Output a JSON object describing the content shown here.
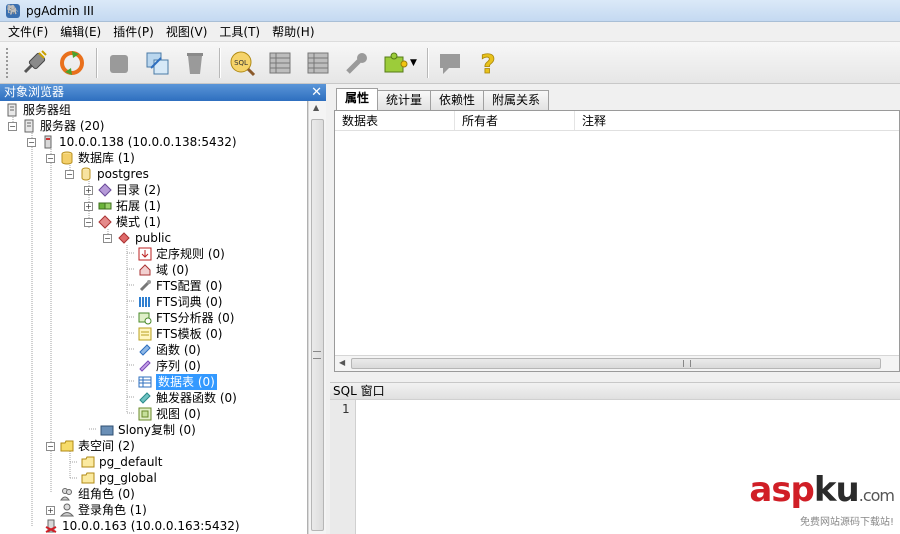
{
  "window": {
    "title": "pgAdmin III"
  },
  "menu": [
    "文件(F)",
    "编辑(E)",
    "插件(P)",
    "视图(V)",
    "工具(T)",
    "帮助(H)"
  ],
  "browser": {
    "title": "对象浏览器"
  },
  "tree": [
    {
      "label": "服务器组",
      "icon": "server-group-icon"
    },
    {
      "label": "服务器 (20)",
      "icon": "servers-icon"
    },
    {
      "label": "10.0.0.138 (10.0.0.138:5432)",
      "icon": "server-icon"
    },
    {
      "label": "数据库 (1)",
      "icon": "databases-icon"
    },
    {
      "label": "postgres",
      "icon": "database-icon"
    },
    {
      "label": "目录 (2)",
      "icon": "catalogs-icon"
    },
    {
      "label": "拓展 (1)",
      "icon": "extensions-icon"
    },
    {
      "label": "模式 (1)",
      "icon": "schemas-icon"
    },
    {
      "label": "public",
      "icon": "schema-icon"
    },
    {
      "label": "定序规则 (0)",
      "icon": "collations-icon"
    },
    {
      "label": "域 (0)",
      "icon": "domains-icon"
    },
    {
      "label": "FTS配置 (0)",
      "icon": "fts-config-icon"
    },
    {
      "label": "FTS词典 (0)",
      "icon": "fts-dict-icon"
    },
    {
      "label": "FTS分析器 (0)",
      "icon": "fts-parser-icon"
    },
    {
      "label": "FTS模板 (0)",
      "icon": "fts-template-icon"
    },
    {
      "label": "函数 (0)",
      "icon": "functions-icon"
    },
    {
      "label": "序列 (0)",
      "icon": "sequences-icon"
    },
    {
      "label": "数据表 (0)",
      "icon": "tables-icon"
    },
    {
      "label": "触发器函数 (0)",
      "icon": "trigger-functions-icon"
    },
    {
      "label": "视图 (0)",
      "icon": "views-icon"
    },
    {
      "label": "Slony复制 (0)",
      "icon": "slony-icon"
    },
    {
      "label": "表空间 (2)",
      "icon": "tablespaces-icon"
    },
    {
      "label": "pg_default",
      "icon": "tablespace-icon"
    },
    {
      "label": "pg_global",
      "icon": "tablespace-icon"
    },
    {
      "label": "组角色 (0)",
      "icon": "group-roles-icon"
    },
    {
      "label": "登录角色 (1)",
      "icon": "login-roles-icon"
    },
    {
      "label": "10.0.0.163 (10.0.0.163:5432)",
      "icon": "server-disconnected-icon"
    }
  ],
  "tabs": [
    "属性",
    "统计量",
    "依赖性",
    "附属关系"
  ],
  "properties": {
    "columns": [
      "数据表",
      "所有者",
      "注释"
    ]
  },
  "sql": {
    "title": "SQL 窗口",
    "line": "1"
  },
  "watermark": {
    "asp": "asp",
    "ku": "ku",
    "dom": ".com",
    "sub": "免费网站源码下载站!"
  }
}
